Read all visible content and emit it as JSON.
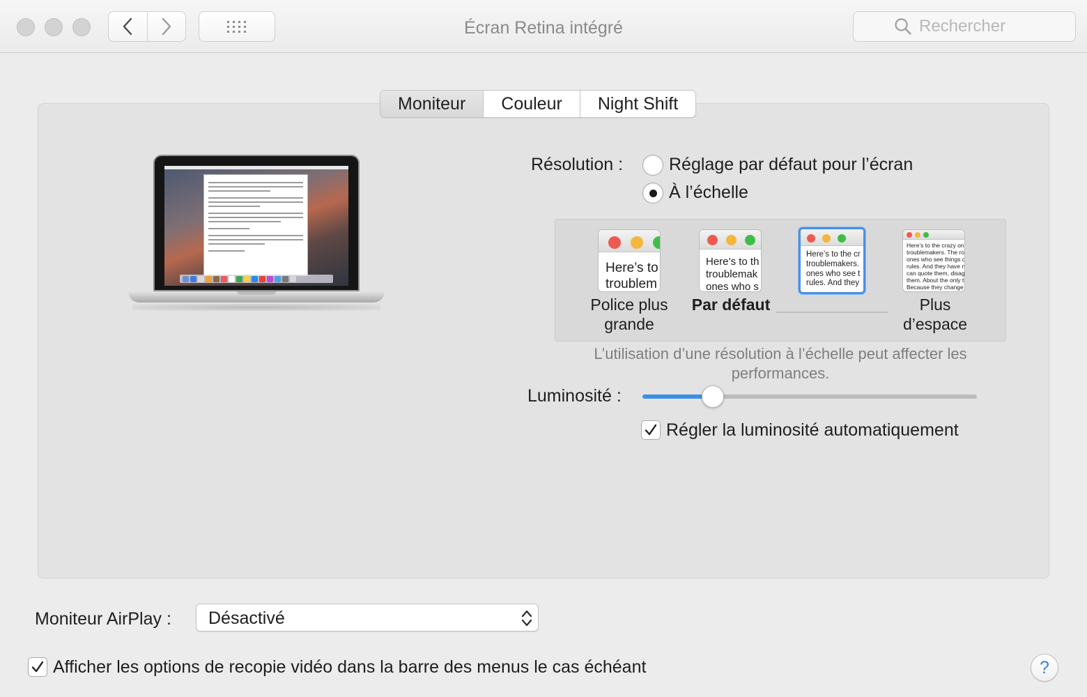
{
  "window": {
    "title": "Écran Retina intégré",
    "search_placeholder": "Rechercher"
  },
  "tabs": [
    {
      "label": "Moniteur",
      "selected": true
    },
    {
      "label": "Couleur",
      "selected": false
    },
    {
      "label": "Night Shift",
      "selected": false
    }
  ],
  "resolution": {
    "label": "Résolution :",
    "options": [
      {
        "label": "Réglage par défaut pour l’écran",
        "selected": false
      },
      {
        "label": "À l’échelle",
        "selected": true
      }
    ]
  },
  "scaling": {
    "options": [
      {
        "label": "Police plus grande",
        "bold": false,
        "selected": false,
        "preview": "Here’s to\ntroublem"
      },
      {
        "label": "Par défaut",
        "bold": true,
        "selected": false,
        "preview": "Here’s to th\ntroublemak\nones who s"
      },
      {
        "label": "",
        "bold": false,
        "selected": true,
        "preview": "Here’s to the cr\ntroublemakers.\nones who see t\nrules. And they"
      },
      {
        "label": "Plus d’espace",
        "bold": false,
        "selected": false,
        "preview": "Here’s to the crazy one\ntroublemakers. The rou\nones who see things dif\nrules. And they have no\ncan quote them, disagre\nthem. About the only th\nBecause they change th"
      }
    ],
    "note": "L’utilisation d’une résolution à l’échelle peut affecter les performances."
  },
  "brightness": {
    "label": "Luminosité :",
    "value": 0.21,
    "auto_label": "Régler la luminosité automatiquement",
    "auto_checked": true
  },
  "airplay": {
    "label": "Moniteur AirPlay :",
    "value": "Désactivé"
  },
  "mirroring": {
    "label": "Afficher les options de recopie vidéo dans la barre des menus le cas échéant",
    "checked": true
  },
  "help": {
    "label": "?"
  },
  "colors": {
    "accent": "#3b8fe8",
    "close_red": "#ee5a52",
    "minimize_yellow": "#f5b73b",
    "zoom_green": "#3fbd48"
  }
}
